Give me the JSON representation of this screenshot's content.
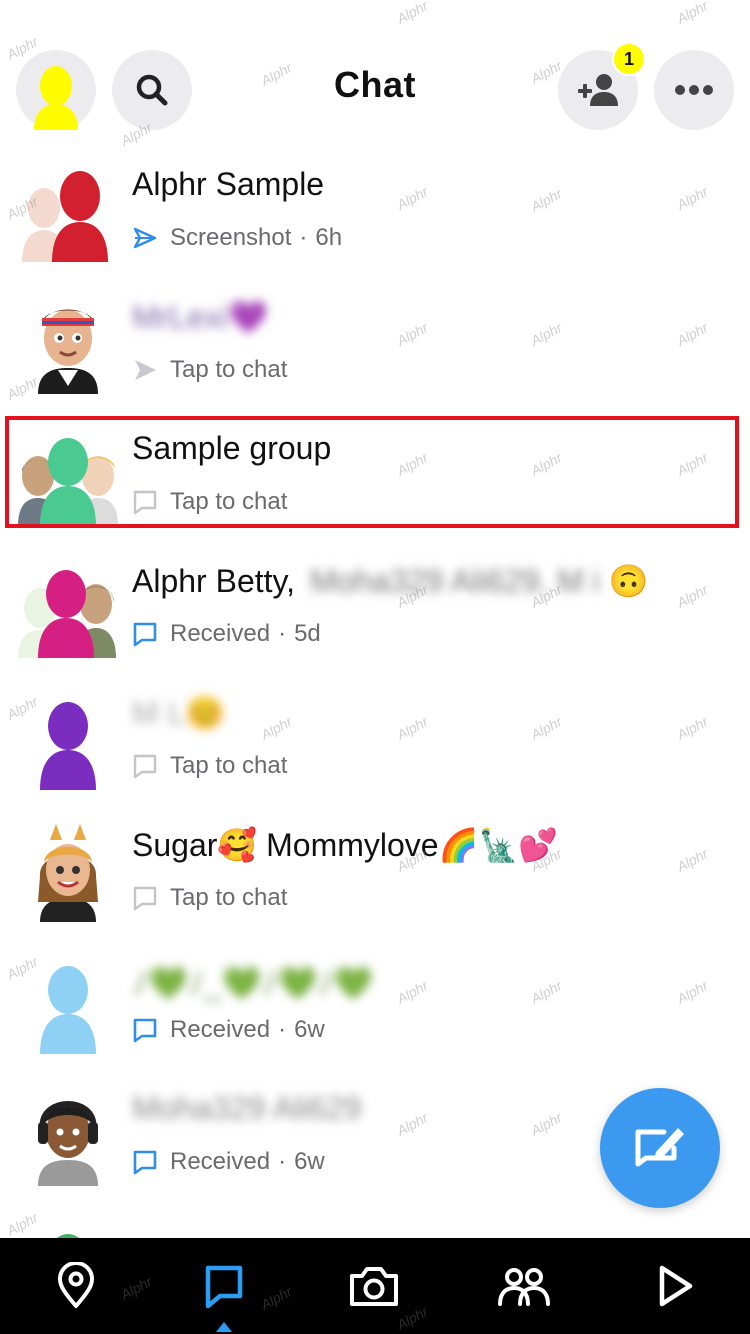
{
  "header": {
    "title": "Chat",
    "friend_badge": "1"
  },
  "chats": [
    {
      "name": "Alphr Sample",
      "status": "Screenshot",
      "time": "6h",
      "status_icon": "screenshot-icon"
    },
    {
      "name": "",
      "status": "Tap to chat",
      "time": "",
      "status_icon": "send-arrow-icon"
    },
    {
      "name": "Sample group",
      "status": "Tap to chat",
      "time": "",
      "status_icon": "chat-bubble-icon"
    },
    {
      "name": "Alphr Betty,",
      "status": "Received",
      "time": "5d",
      "status_icon": "chat-bubble-icon",
      "emoji": "🙃"
    },
    {
      "name": "",
      "status": "Tap to chat",
      "time": "",
      "status_icon": "chat-bubble-icon"
    },
    {
      "name": "Sugar🥰 Mommylove🌈🗽💕",
      "status": "Tap to chat",
      "time": "",
      "status_icon": "chat-bubble-icon"
    },
    {
      "name": "",
      "status": "Received",
      "time": "6w",
      "status_icon": "chat-bubble-icon"
    },
    {
      "name": "",
      "status": "Received",
      "time": "6w",
      "status_icon": "chat-bubble-icon"
    }
  ],
  "blurred": {
    "row2": "MrLexi💜",
    "row4": "Moha329 Ali629, M i",
    "row5": "M L😊",
    "row7": "ﾉ💚ﾉ_💚ﾉ💚ﾉ💚",
    "row8": "Moha329 Ali629"
  },
  "watermark": "Alphr",
  "colors": {
    "accent_blue": "#3b9af0",
    "highlight_red": "#e3101e",
    "badge_yellow": "#fffc00"
  },
  "nav": [
    "map-icon",
    "chat-icon",
    "camera-icon",
    "friends-icon",
    "stories-icon"
  ]
}
